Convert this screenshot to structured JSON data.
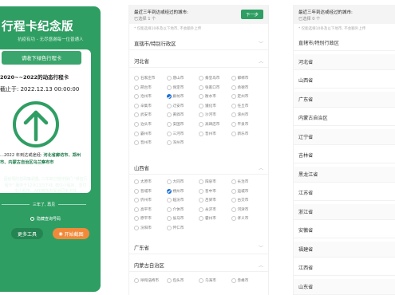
{
  "panel1": {
    "title": "行程卡纪念版",
    "subtitle": "抗疫有功 - 无尽感谢每一位普通人",
    "card_tab": "请收下绿色行程卡",
    "card_name": "2020~~2022的动态行程卡",
    "card_time": "截止于: 2022.12.13 00:00:00",
    "route_prefix": "...2022 年到达或途经: ",
    "route_highlight": "河北省廊坊市、郑州市、内蒙古自治区乌兰察布市",
    "note": "因疫情防控政策调整, 三年来它陪伴我们 \"通信行程卡\" 服务于12月13日下线, 微信小程序、支付宝小程序、APP等所有渠道同步下线",
    "divider_text": "三年了, 再见",
    "hide_label": "隐藏查询号码",
    "btn_tools": "更多工具",
    "btn_shot": "开始截图"
  },
  "panel2": {
    "question": "最近三年到达或经过的城市:",
    "selected": "已选择 1 个",
    "next": "下一步",
    "hint": "* 仅能选择10条及以下地市, 不会额外上传",
    "sections": [
      {
        "name": "直辖市/特别行政区"
      },
      {
        "name": "河北省"
      },
      {
        "name": "山西省"
      },
      {
        "name": "广东省"
      },
      {
        "name": "内蒙古自治区"
      }
    ],
    "hebei_cities": [
      "石家庄市",
      "唐山市",
      "秦皇岛市",
      "邯郸市",
      "邢台市",
      "保定市",
      "张家口市",
      "承德市",
      "沧州市",
      "廊坊市",
      "衡水市",
      "定州市",
      "辛集市",
      "迁安市",
      "遵化市",
      "任丘市",
      "武安市",
      "黄骅市",
      "沙河市",
      "涿州市",
      "泊头市",
      "安国市",
      "高碑店市",
      "平泉市",
      "霸州市",
      "三河市",
      "晋州市",
      "新乐市",
      "晋州市",
      "深州市"
    ],
    "hebei_checked": [
      9
    ],
    "shanxi_cities": [
      "太原市",
      "大同市",
      "阳泉市",
      "长治市",
      "晋城市",
      "朔州市",
      "晋中市",
      "运城市",
      "忻州市",
      "临汾市",
      "吕梁市",
      "古交市",
      "高平市",
      "介休市",
      "永济市",
      "河津市",
      "原平市",
      "侯马市",
      "霍州市",
      "孝义市",
      "汾阳市",
      "怀仁市"
    ],
    "shanxi_checked": [
      5
    ],
    "neimenggu_cities": [
      "呼和浩特市",
      "包头市",
      "乌海市",
      "赤峰市"
    ]
  },
  "panel3": {
    "question": "最近三年到达或经过的城市:",
    "selected": "已选择 0 个",
    "hint": "* 仅能选择10条及以下地市, 不会额外上传",
    "provinces": [
      "直辖市/特别行政区",
      "河北省",
      "山西省",
      "广东省",
      "内蒙古自治区",
      "辽宁省",
      "吉林省",
      "黑龙江省",
      "江苏省",
      "浙江省",
      "安徽省",
      "福建省",
      "江西省",
      "山东省"
    ]
  },
  "colors": {
    "green": "#2f9e63",
    "orange": "#f08a3a",
    "blue": "#1a6fd8"
  }
}
